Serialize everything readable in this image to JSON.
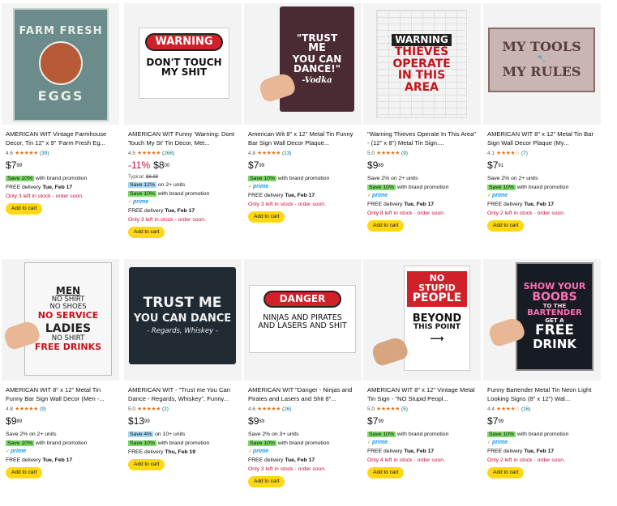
{
  "products": [
    {
      "title": "AMERICAN WIT Vintage Farmhouse Decor, Tin 12\" x 9\" 'Farm Fresh Eg...",
      "rating": "4.6",
      "stars": "★★★★★",
      "count": "(39)",
      "discount": "",
      "price_whole": "7",
      "price_frac": "99",
      "typical": "",
      "badge": "Save 10%",
      "badge_text": "with brand promotion",
      "badge2": "",
      "badge2_text": "",
      "prime": "",
      "delivery_prefix": "FREE delivery",
      "delivery_date": "Tue, Feb 17",
      "stock": "Only 3 left in stock - order soon.",
      "cart": "Add to cart",
      "sign": {
        "line1": "FARM FRESH",
        "line2": "EGGS"
      }
    },
    {
      "title": "AMERICAN WIT Funny 'Warning: Dont Touch My St' Tin Decor, Met...",
      "rating": "4.5",
      "stars": "★★★★★",
      "count": "(268)",
      "discount": "-11%",
      "price_whole": "8",
      "price_frac": "00",
      "typical": "Typical:",
      "typical_price": "$8.99",
      "badge": "Save 12%",
      "badge_text": "on 2+ units",
      "badge2": "Save 10%",
      "badge2_text": "with brand promotion",
      "prime": "prime",
      "delivery_prefix": "FREE delivery",
      "delivery_date": "Tue, Feb 17",
      "stock": "Only 3 left in stock - order soon.",
      "cart": "Add to cart",
      "sign": {
        "line1": "WARNING",
        "line2": "DON'T TOUCH",
        "line3": "MY SHIT"
      }
    },
    {
      "title": "American Wit 8\" x 12\" Metal Tin Funny Bar Sign Wall Decor Plaque...",
      "rating": "4.8",
      "stars": "★★★★★",
      "count": "(13)",
      "discount": "",
      "price_whole": "7",
      "price_frac": "99",
      "typical": "",
      "badge": "Save 10%",
      "badge_text": "with brand promotion",
      "badge2": "",
      "badge2_text": "",
      "prime": "prime",
      "delivery_prefix": "FREE delivery",
      "delivery_date": "Tue, Feb 17",
      "stock": "Only 3 left in stock - order soon.",
      "cart": "Add to cart",
      "sign": {
        "line1": "\"TRUST",
        "line2": "ME",
        "line3": "YOU CAN",
        "line4": "DANCE!\"",
        "line5": "-Vodka"
      }
    },
    {
      "title": "\"Warning Thieves Operate In This Area\" - (12\" x 8\") Metal Tin Sign....",
      "rating": "5.0",
      "stars": "★★★★★",
      "count": "(9)",
      "discount": "",
      "price_whole": "9",
      "price_frac": "89",
      "typical": "",
      "badge": "",
      "badge_text": "",
      "plain1_prefix": "Save 2%",
      "plain1_text": "on 2+ units",
      "badge2": "Save 10%",
      "badge2_text": "with brand promotion",
      "prime": "prime",
      "delivery_prefix": "FREE delivery",
      "delivery_date": "Tue, Feb 17",
      "stock": "Only 8 left in stock - order soon.",
      "cart": "Add to cart",
      "sign": {
        "line1": "WARNING",
        "line2": "THIEVES",
        "line3": "OPERATE",
        "line4": "IN THIS",
        "line5": "AREA"
      }
    },
    {
      "title": "AMERICAN WIT 8\" x 12\" Metal Tin Bar Sign Wall Decor Plaque (My...",
      "rating": "4.1",
      "stars": "★★★★☆",
      "count": "(7)",
      "discount": "",
      "price_whole": "7",
      "price_frac": "91",
      "typical": "",
      "badge": "",
      "badge_text": "",
      "plain1_prefix": "Save 2%",
      "plain1_text": "on 2+ units",
      "badge2": "Save 10%",
      "badge2_text": "with brand promotion",
      "prime": "prime",
      "delivery_prefix": "FREE delivery",
      "delivery_date": "Tue, Feb 17",
      "stock": "Only 2 left in stock - order soon.",
      "cart": "Add to cart",
      "sign": {
        "line1": "MY TOOLS",
        "line2": "MY RULES"
      }
    },
    {
      "title": "AMERICAN WIT 8\" x 12\" Metal Tin Funny Bar Sign Wall Decor (Men -...",
      "rating": "4.8",
      "stars": "★★★★★",
      "count": "(9)",
      "discount": "",
      "price_whole": "9",
      "price_frac": "89",
      "typical": "",
      "badge": "",
      "badge_text": "",
      "plain1_prefix": "Save 2%",
      "plain1_text": "on 2+ units",
      "badge2": "Save 10%",
      "badge2_text": "with brand promotion",
      "prime": "prime",
      "delivery_prefix": "FREE delivery",
      "delivery_date": "Tue, Feb 17",
      "stock": "",
      "cart": "Add to cart",
      "sign": {
        "line1": "MEN",
        "line2": "NO SHIRT",
        "line3": "NO SHOES",
        "line4": "NO SERVICE",
        "line5": "LADIES",
        "line6": "NO SHIRT",
        "line7": "FREE DRINKS"
      }
    },
    {
      "title": "AMERICAN WIT - \"Trust me You Can Dance - Regards, Whiskey\", Funny...",
      "rating": "5.0",
      "stars": "★★★★★",
      "count": "(2)",
      "discount": "",
      "price_whole": "13",
      "price_frac": "99",
      "typical": "",
      "badge": "Save 4%",
      "badge_text": "on 10+ units",
      "badge_blue": true,
      "badge2": "Save 10%",
      "badge2_text": "with brand promotion",
      "prime": "",
      "delivery_prefix": "FREE delivery",
      "delivery_date": "Thu, Feb 19",
      "stock": "",
      "cart": "Add to cart",
      "sign": {
        "line1": "TRUST ME",
        "line2": "YOU CAN DANCE",
        "line3": "- Regards, Whiskey -"
      }
    },
    {
      "title": "AMERICAN WIT \"Danger - Ninjas and Pirates and Lasers and Shit 8\"...",
      "rating": "4.6",
      "stars": "★★★★★",
      "count": "(26)",
      "discount": "",
      "price_whole": "9",
      "price_frac": "89",
      "typical": "",
      "badge": "",
      "badge_text": "",
      "plain1_prefix": "Save 2%",
      "plain1_text": "on 3+ units",
      "badge2": "Save 10%",
      "badge2_text": "with brand promotion",
      "prime": "prime",
      "delivery_prefix": "FREE delivery",
      "delivery_date": "Tue, Feb 17",
      "stock": "Only 3 left in stock - order soon.",
      "cart": "Add to cart",
      "sign": {
        "line1": "DANGER",
        "line2": "NINJAS AND PIRATES",
        "line3": "AND LASERS AND SHIT"
      }
    },
    {
      "title": "AMERICAN WIT 8\" x 12\" Vintage Metal Tin Sign - \"NO Stupid Peopl...",
      "rating": "5.0",
      "stars": "★★★★★",
      "count": "(5)",
      "discount": "",
      "price_whole": "7",
      "price_frac": "99",
      "typical": "",
      "badge": "Save 10%",
      "badge_text": "with brand promotion",
      "badge2": "",
      "badge2_text": "",
      "prime": "prime",
      "delivery_prefix": "FREE delivery",
      "delivery_date": "Tue, Feb 17",
      "stock": "Only 4 left in stock - order soon.",
      "cart": "Add to cart",
      "sign": {
        "line1": "NO STUPID",
        "line2": "PEOPLE",
        "line3": "BEYOND",
        "line4": "THIS POINT"
      }
    },
    {
      "title": "Funny Bartender Metal Tin Neon Light Looking Signs (8\" x 12\") Wal...",
      "rating": "4.4",
      "stars": "★★★★☆",
      "count": "(16)",
      "discount": "",
      "price_whole": "7",
      "price_frac": "99",
      "typical": "",
      "badge": "Save 10%",
      "badge_text": "with brand promotion",
      "badge2": "",
      "badge2_text": "",
      "prime": "prime",
      "delivery_prefix": "FREE delivery",
      "delivery_date": "Tue, Feb 17",
      "stock": "Only 2 left in stock - order soon.",
      "cart": "Add to cart",
      "sign": {
        "line1": "SHOW YOUR",
        "line2": "BOOBS",
        "line3": "TO THE",
        "line4": "BARTENDER",
        "line5": "GET A",
        "line6": "FREE",
        "line7": "DRINK"
      }
    }
  ],
  "colors": {
    "badge_green": "#7fda69",
    "badge_blue": "#a7d8f5",
    "stock_red": "#cc0c39",
    "prime_blue": "#1399ff",
    "cart_yellow": "#ffd814",
    "star_orange": "#de7921"
  }
}
